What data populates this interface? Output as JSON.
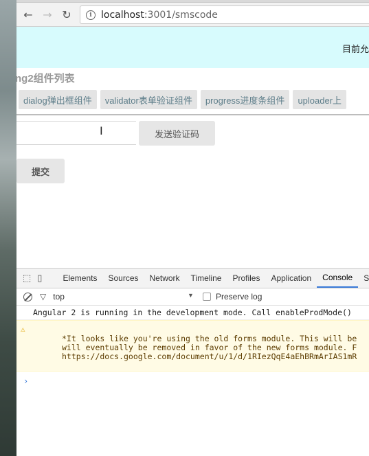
{
  "browser": {
    "url_host": "localhost",
    "url_rest": ":3001/smscode"
  },
  "page": {
    "banner_text": "目前允",
    "list_title": "ng2组件列表",
    "tabs": [
      {
        "label": "dialog弹出框组件"
      },
      {
        "label": "validator表单验证组件"
      },
      {
        "label": "progress进度条组件"
      },
      {
        "label": "uploader上"
      }
    ],
    "send_code_label": "发送验证码",
    "submit_label": "提交"
  },
  "devtools": {
    "tabs": [
      {
        "label": "Elements"
      },
      {
        "label": "Sources"
      },
      {
        "label": "Network"
      },
      {
        "label": "Timeline"
      },
      {
        "label": "Profiles"
      },
      {
        "label": "Application"
      },
      {
        "label": "Console"
      },
      {
        "label": "S"
      }
    ],
    "active_tab": "Console",
    "context": "top",
    "preserve_log_label": "Preserve log",
    "log_line": "Angular 2 is running in the development mode. Call enableProdMode()",
    "warning_text": "*It looks like you're using the old forms module. This will be\nwill eventually be removed in favor of the new forms module. F\nhttps://docs.google.com/document/u/1/d/1RIezQqE4aEhBRmArIAS1mR",
    "prompt": "›"
  }
}
